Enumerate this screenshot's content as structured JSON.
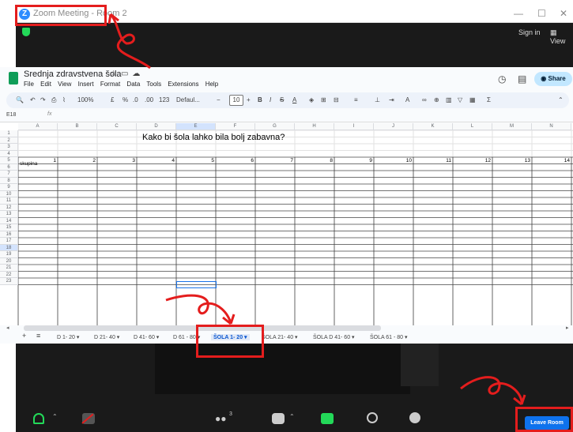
{
  "zoom": {
    "title": "Zoom Meeting - Room 2",
    "sign_in": "Sign in",
    "view": "View",
    "leave_room": "Leave Room",
    "participants_count": "3"
  },
  "sheets": {
    "doc_title": "Srednja zdravstvena šola",
    "menu": [
      "File",
      "Edit",
      "View",
      "Insert",
      "Format",
      "Data",
      "Tools",
      "Extensions",
      "Help"
    ],
    "share": "Share",
    "zoom_level": "100%",
    "font": "Defaul...",
    "font_size": "10",
    "currency": "£",
    "percent": "%",
    "dec_less": ".0",
    "dec_more": ".00",
    "num_format": "123",
    "cell_ref": "E18",
    "fx": "fx",
    "columns": [
      "A",
      "B",
      "C",
      "D",
      "E",
      "F",
      "G",
      "H",
      "I",
      "J",
      "K",
      "L",
      "M",
      "N"
    ],
    "rows": [
      "1",
      "2",
      "3",
      "4",
      "5",
      "6",
      "7",
      "8",
      "9",
      "10",
      "11",
      "12",
      "13",
      "14",
      "15",
      "16",
      "17",
      "18",
      "19",
      "20",
      "21",
      "22",
      "23"
    ],
    "heading": "Kako bi šola lahko bila bolj zabavna?",
    "a4_label": "skupina",
    "row5_numbers": [
      "1",
      "2",
      "3",
      "4",
      "5",
      "6",
      "7",
      "8",
      "9",
      "10",
      "11",
      "12",
      "13",
      "14"
    ],
    "tabs": [
      "D 1- 20",
      "D 21- 40",
      "D 41- 60",
      "D 61 - 80",
      "ŠOLA 1- 20",
      "ŠOLA 21- 40",
      "ŠOLA D 41- 60",
      "ŠOLA 61 - 80"
    ],
    "add_sheet": "+",
    "all_sheets": "≡"
  },
  "colors": {
    "annotation_red": "#e41d1d",
    "zoom_dark": "#1a1a1a",
    "leave_blue": "#0e72ed",
    "sheets_green": "#0f9d58"
  }
}
